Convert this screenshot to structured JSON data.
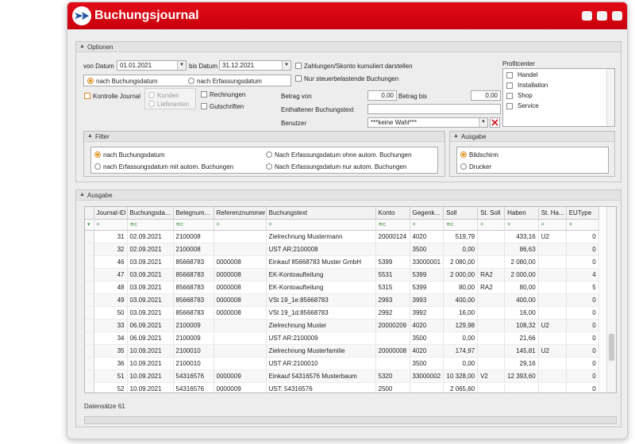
{
  "window": {
    "title": "Buchungsjournal"
  },
  "optionen": {
    "header": "Optionen",
    "von_datum_label": "von Datum",
    "von_datum": "01.01.2021",
    "bis_datum_label": "bis Datum",
    "bis_datum": "31.12.2021",
    "datum_radio": [
      "nach Buchungsdatum",
      "nach Erfassungsdatum"
    ],
    "kontrolle_journal": "Kontrolle Journal",
    "kunden": "Kunden",
    "lieferanten": "Lieferanten",
    "rechnungen": "Rechnungen",
    "gutschriften": "Gutschriften",
    "zahlungen_label": "Zahlungen/Skonto kumuliert darstellen",
    "steuer_label": "Nur steuerbelastende Buchungen",
    "betrag_von_label": "Betrag von",
    "betrag_von": "0,00",
    "betrag_bis_label": "Betrag bis",
    "betrag_bis": "0,00",
    "buchungstext_label": "Enthaltener Buchungstext",
    "buchungstext": "",
    "benutzer_label": "Benutzer",
    "benutzer": "***keine Wahl***",
    "profitcenter_label": "Profitcenter",
    "profitcenter": [
      "Handel",
      "Installation",
      "Shop",
      "Service"
    ]
  },
  "filter": {
    "header": "Filter",
    "options": [
      "nach Buchungsdatum",
      "Nach Erfassungsdatum ohne autom. Buchungen",
      "nach Erfassungsdatum mit autom. Buchungen",
      "Nach Erfassungsdatum nur autom. Buchungen"
    ]
  },
  "ausgabe_opts": {
    "header": "Ausgabe",
    "options": [
      "Bildschirm",
      "Drucker"
    ]
  },
  "ausgabe": {
    "header": "Ausgabe",
    "columns": [
      "Journal-ID",
      "Buchungsda...",
      "Belegnum...",
      "Referenznummer",
      "Buchungstext",
      "Konto",
      "Gegenk...",
      "Soll",
      "St. Soll",
      "Haben",
      "St. Ha...",
      "EUType"
    ],
    "filter_symbol": "=",
    "filter_icon": "≋c",
    "rows": [
      [
        "31",
        "02.09.2021",
        "2100008",
        "",
        "Zielrechnung Mustermann",
        "20000124",
        "4020",
        "519,79",
        "",
        "433,16",
        "U2",
        "0"
      ],
      [
        "32",
        "02.09.2021",
        "2100008",
        "",
        "UST AR:2100008",
        "",
        "3500",
        "0,00",
        "",
        "86,63",
        "",
        "0"
      ],
      [
        "46",
        "03.09.2021",
        "85668783",
        "0000008",
        "Einkauf 85668783 Muster GmbH",
        "5399",
        "33000001",
        "2 080,00",
        "",
        "2 080,00",
        "",
        "0"
      ],
      [
        "47",
        "03.09.2021",
        "85668783",
        "0000008",
        "EK-Kontoaufteilung",
        "5531",
        "5399",
        "2 000,00",
        "RA2",
        "2 000,00",
        "",
        "4"
      ],
      [
        "48",
        "03.09.2021",
        "85668783",
        "0000008",
        "EK-Kontoaufteilung",
        "5315",
        "5399",
        "80,00",
        "RA2",
        "80,00",
        "",
        "5"
      ],
      [
        "49",
        "03.09.2021",
        "85668783",
        "0000008",
        "VSt 19_1e:85668783",
        "2993",
        "3993",
        "400,00",
        "",
        "400,00",
        "",
        "0"
      ],
      [
        "50",
        "03.09.2021",
        "85668783",
        "0000008",
        "VSt 19_1d:85668783",
        "2992",
        "3992",
        "16,00",
        "",
        "16,00",
        "",
        "0"
      ],
      [
        "33",
        "06.09.2021",
        "2100009",
        "",
        "Zielrechnung Muster",
        "20000209",
        "4020",
        "129,98",
        "",
        "108,32",
        "U2",
        "0"
      ],
      [
        "34",
        "06.09.2021",
        "2100009",
        "",
        "UST AR:2100009",
        "",
        "3500",
        "0,00",
        "",
        "21,66",
        "",
        "0"
      ],
      [
        "35",
        "10.09.2021",
        "2100010",
        "",
        "Zielrechnung Musterfamilie",
        "20000008",
        "4020",
        "174,97",
        "",
        "145,81",
        "U2",
        "0"
      ],
      [
        "36",
        "10.09.2021",
        "2100010",
        "",
        "UST AR:2100010",
        "",
        "3500",
        "0,00",
        "",
        "29,16",
        "",
        "0"
      ],
      [
        "51",
        "10.09.2021",
        "54316576",
        "0000009",
        "Einkauf 54316576 Musterbaum",
        "5320",
        "33000002",
        "10 328,00",
        "V2",
        "12 393,60",
        "",
        "0"
      ],
      [
        "52",
        "10.09.2021",
        "54316576",
        "0000009",
        "UST: 54316576",
        "2500",
        "",
        "2 065,60",
        "",
        "",
        "",
        "0"
      ]
    ],
    "datensaetze": "Datensätze 61"
  }
}
